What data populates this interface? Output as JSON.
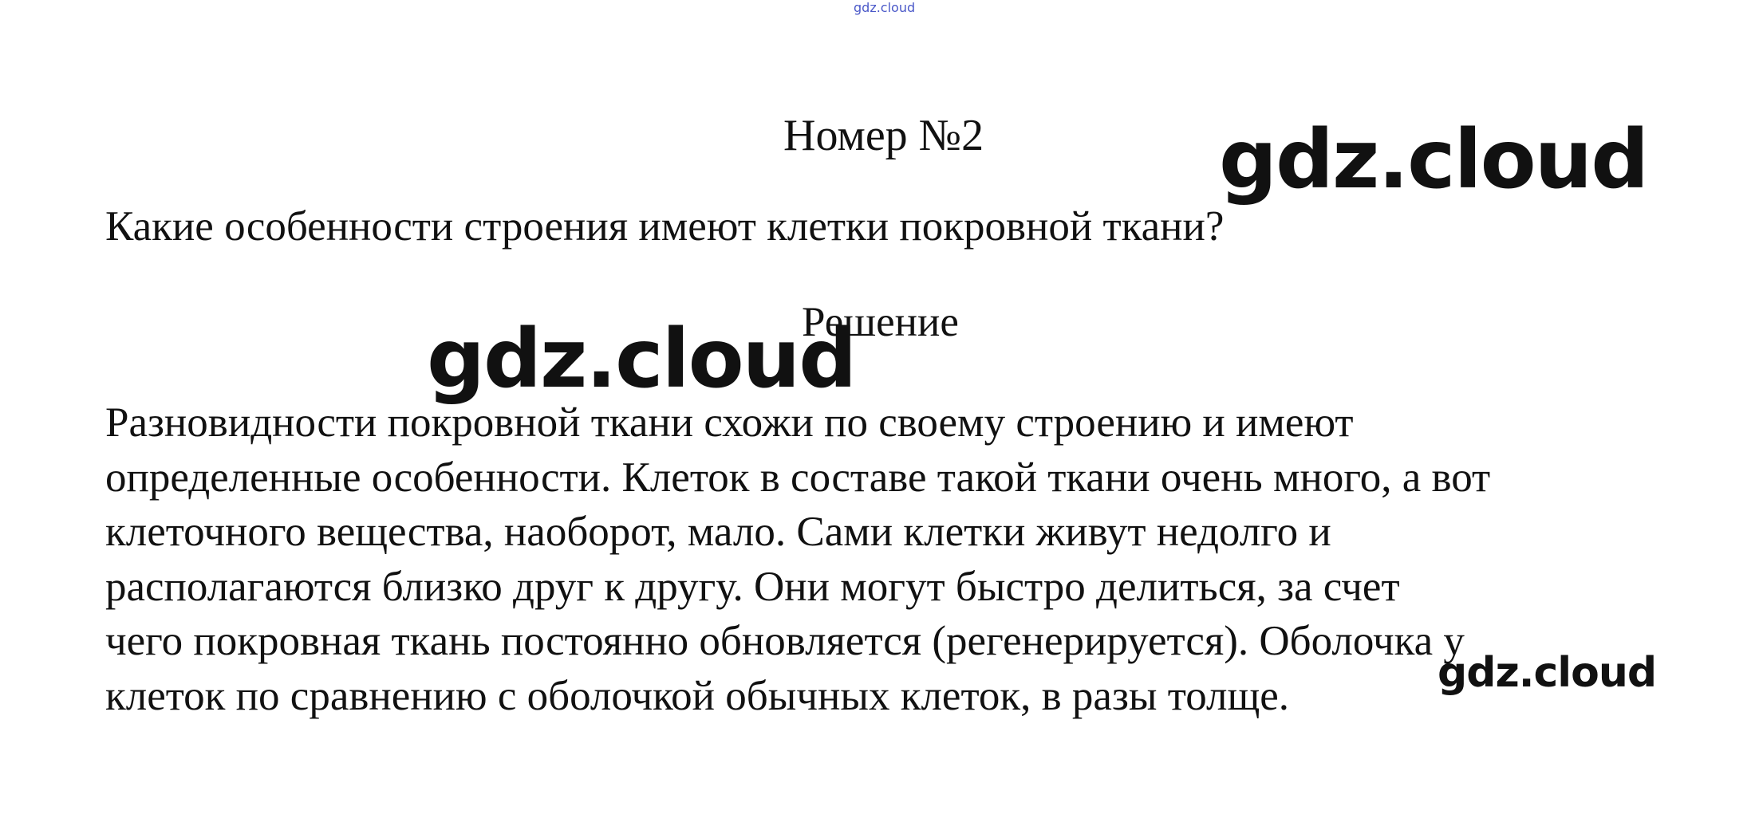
{
  "watermark": {
    "top": "gdz.cloud",
    "large_right": "gdz.cloud",
    "large_left": "gdz.cloud",
    "small_bottom": "gdz.cloud"
  },
  "document": {
    "title": "Номер №2",
    "question": "Какие особенности строения имеют клетки покровной ткани?",
    "solution_heading": "Решение",
    "answer_lines": [
      "Разновидности покровной ткани схожи по своему строению и имеют",
      "определенные особенности. Клеток в составе такой ткани очень много, а вот",
      "клеточного вещества, наоборот, мало. Сами клетки живут недолго и",
      "располагаются близко друг к другу. Они могут быстро делиться, за счет",
      "чего покровная ткань постоянно обновляется (регенерируется). Оболочка у",
      "клеток по сравнению с оболочкой обычных клеток, в разы толще."
    ]
  },
  "colors": {
    "text": "#111111",
    "top_watermark": "#4a58c8",
    "background": "#ffffff"
  }
}
